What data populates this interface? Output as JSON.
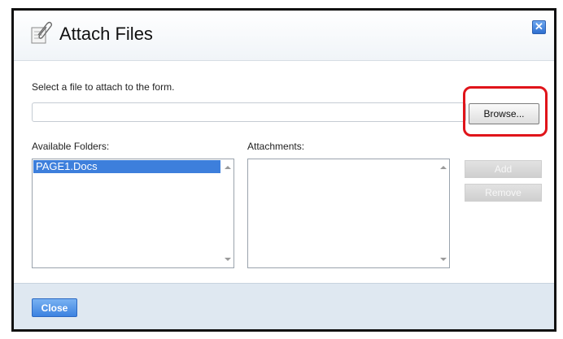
{
  "dialog": {
    "title": "Attach Files",
    "icon": "paperclip-document-icon",
    "close_icon": "close-x-icon"
  },
  "form": {
    "instruction": "Select a file to attach to the form.",
    "file_path_value": "",
    "browse_label": "Browse..."
  },
  "folders": {
    "label": "Available Folders:",
    "items": [
      "PAGE1.Docs"
    ],
    "selected_index": 0
  },
  "attachments": {
    "label": "Attachments:",
    "items": []
  },
  "actions": {
    "add_label": "Add",
    "remove_label": "Remove"
  },
  "footer": {
    "close_label": "Close"
  },
  "colors": {
    "selection": "#3d7fdc",
    "highlight_ring": "#e0141a",
    "footer_bg": "#dfe8f1"
  }
}
